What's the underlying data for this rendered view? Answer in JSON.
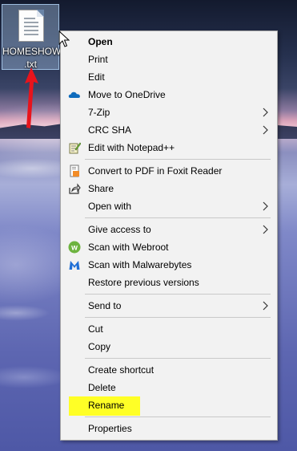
{
  "desktop": {
    "file": {
      "name_line1": "HOMESHOW",
      "name_line2": ".txt",
      "icon": "text-file-icon"
    }
  },
  "context_menu": {
    "items": [
      {
        "label": "Open",
        "bold": true
      },
      {
        "label": "Print"
      },
      {
        "label": "Edit"
      },
      {
        "label": "Move to OneDrive",
        "icon": "onedrive-cloud-icon"
      },
      {
        "label": "7-Zip",
        "submenu": true
      },
      {
        "label": "CRC SHA",
        "submenu": true
      },
      {
        "label": "Edit with Notepad++",
        "icon": "notepad-plus-plus-icon"
      },
      {
        "label": "Convert to PDF in Foxit Reader",
        "icon": "foxit-pdf-icon"
      },
      {
        "label": "Share",
        "icon": "share-icon"
      },
      {
        "label": "Open with",
        "submenu": true
      },
      {
        "label": "Give access to",
        "submenu": true
      },
      {
        "label": "Scan with Webroot",
        "icon": "webroot-icon"
      },
      {
        "label": "Scan with Malwarebytes",
        "icon": "malwarebytes-icon"
      },
      {
        "label": "Restore previous versions"
      },
      {
        "label": "Send to",
        "submenu": true
      },
      {
        "label": "Cut"
      },
      {
        "label": "Copy"
      },
      {
        "label": "Create shortcut"
      },
      {
        "label": "Delete"
      },
      {
        "label": "Rename",
        "highlighted": true
      },
      {
        "label": "Properties"
      }
    ]
  },
  "colors": {
    "highlight": "#ffff26",
    "annotation_arrow": "#e8141c",
    "menu_background": "#f2f2f2"
  }
}
